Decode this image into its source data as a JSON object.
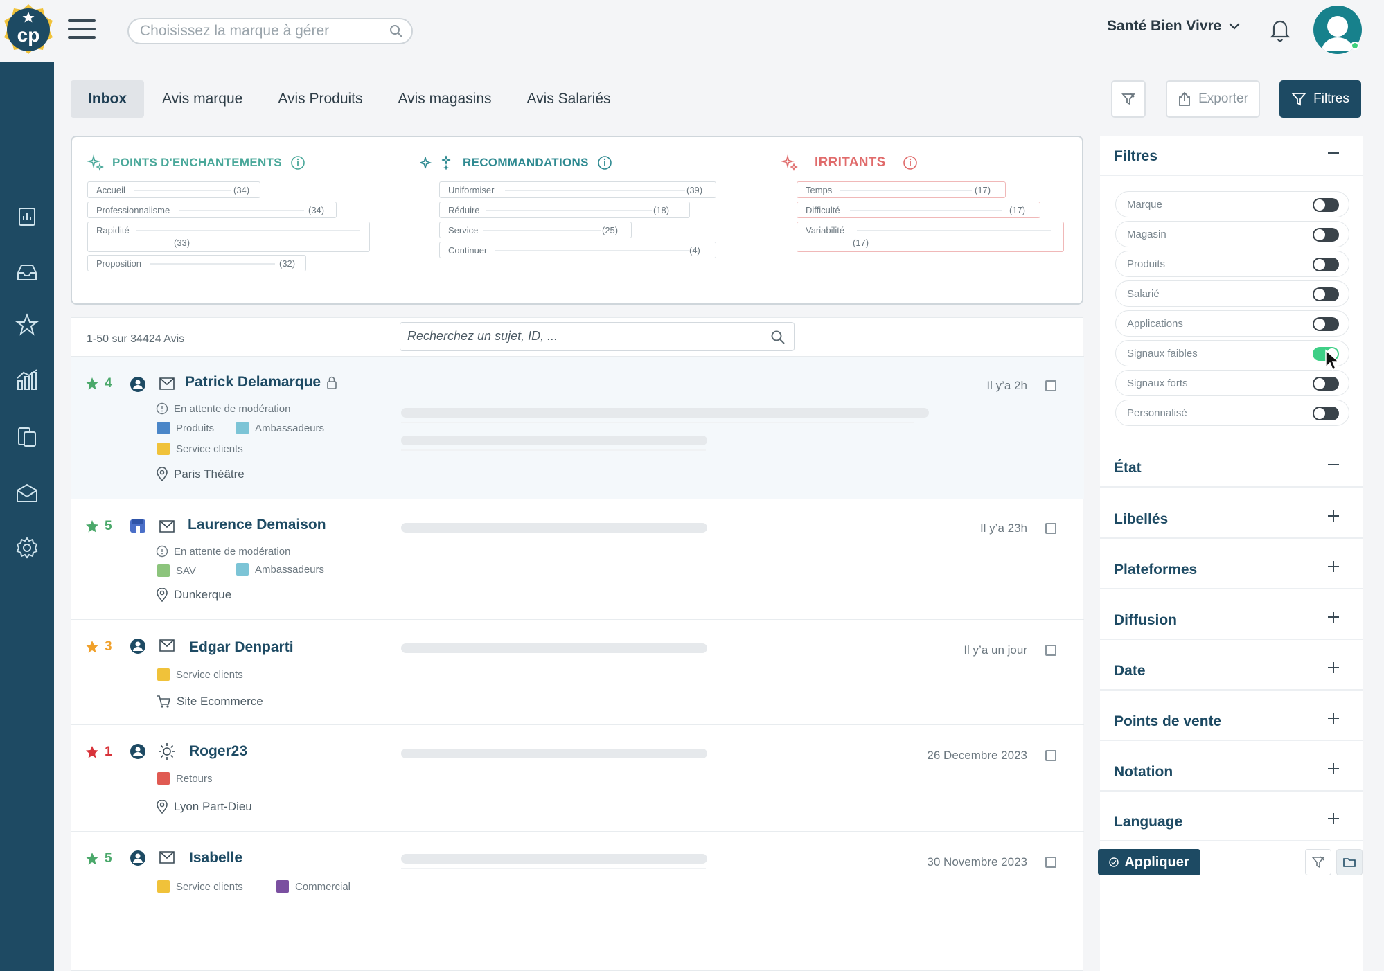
{
  "header": {
    "logo_text": "cp",
    "brand_search_placeholder": "Choisissez la marque à gérer",
    "account_name": "Santé Bien Vivre"
  },
  "tabs": [
    {
      "label": "Inbox",
      "active": true
    },
    {
      "label": "Avis marque"
    },
    {
      "label": "Avis Produits"
    },
    {
      "label": "Avis magasins"
    },
    {
      "label": "Avis Salariés"
    }
  ],
  "toolbar": {
    "export_label": "Exporter",
    "filters_label": "Filtres"
  },
  "insights": {
    "enchantements": {
      "title": "POINTS D'ENCHANTEMENTS",
      "color": "#4aa89a",
      "items": [
        {
          "label": "Accueil",
          "count": "(34)"
        },
        {
          "label": "Professionnalisme",
          "count": "(34)"
        },
        {
          "label": "Rapidité",
          "count": "(33)"
        },
        {
          "label": "Proposition",
          "count": "(32)"
        }
      ]
    },
    "recommandations": {
      "title": "RECOMMANDATIONS",
      "color": "#2f8a91",
      "items": [
        {
          "label": "Uniformiser",
          "count": "(39)"
        },
        {
          "label": "Réduire",
          "count": "(18)"
        },
        {
          "label": "Service",
          "count": "(25)"
        },
        {
          "label": "Continuer",
          "count": "(4)"
        }
      ]
    },
    "irritants": {
      "title": "IRRITANTS",
      "color": "#e06b6b",
      "items": [
        {
          "label": "Temps",
          "count": "(17)"
        },
        {
          "label": "Difficulté",
          "count": "(17)"
        },
        {
          "label": "Variabilité",
          "count": "(17)"
        }
      ]
    }
  },
  "list": {
    "count_label": "1-50 sur 34424 Avis",
    "search_placeholder": "Recherchez un sujet, ID, ...",
    "reviews": [
      {
        "rating": "4",
        "rating_color": "#4aa86a",
        "name": "Patrick Delamarque",
        "locked": true,
        "status": "En attente de modération",
        "tags": [
          {
            "label": "Produits",
            "color": "#4a86c8"
          },
          {
            "label": "Ambassadeurs",
            "color": "#7cc4d6"
          },
          {
            "label": "Service clients",
            "color": "#f0c23a"
          }
        ],
        "location": "Paris Théâtre",
        "time": "Il y’a 2h"
      },
      {
        "rating": "5",
        "rating_color": "#4aa86a",
        "name": "Laurence Demaison",
        "status": "En attente de modération",
        "tags": [
          {
            "label": "SAV",
            "color": "#8cc47c"
          },
          {
            "label": "Ambassadeurs",
            "color": "#7cc4d6"
          }
        ],
        "location": "Dunkerque",
        "time": "Il y’a 23h"
      },
      {
        "rating": "3",
        "rating_color": "#f0a02a",
        "name": "Edgar Denparti",
        "tags": [
          {
            "label": "Service clients",
            "color": "#f0c23a"
          }
        ],
        "location": "Site Ecommerce",
        "time": "Il y’a un jour"
      },
      {
        "rating": "1",
        "rating_color": "#d8333a",
        "name": "Roger23",
        "tags": [
          {
            "label": "Retours",
            "color": "#e05a52"
          }
        ],
        "location": "Lyon Part-Dieu",
        "time": "26 Decembre 2023"
      },
      {
        "rating": "5",
        "rating_color": "#4aa86a",
        "name": "Isabelle",
        "tags": [
          {
            "label": "Service clients",
            "color": "#f0c23a"
          },
          {
            "label": "Commercial",
            "color": "#7a4fa0"
          }
        ],
        "time": "30 Novembre 2023"
      }
    ]
  },
  "filters": {
    "title": "Filtres",
    "toggles": [
      {
        "label": "Marque",
        "on": false
      },
      {
        "label": "Magasin",
        "on": false
      },
      {
        "label": "Produits",
        "on": false
      },
      {
        "label": "Salarié",
        "on": false
      },
      {
        "label": "Applications",
        "on": false
      },
      {
        "label": "Signaux faibles",
        "on": true
      },
      {
        "label": "Signaux forts",
        "on": false
      },
      {
        "label": "Personnalisé",
        "on": false
      }
    ],
    "sections": [
      "État",
      "Libellés",
      "Plateformes",
      "Diffusion",
      "Date",
      "Points de vente",
      "Notation",
      "Language"
    ],
    "apply_label": "Appliquer"
  }
}
